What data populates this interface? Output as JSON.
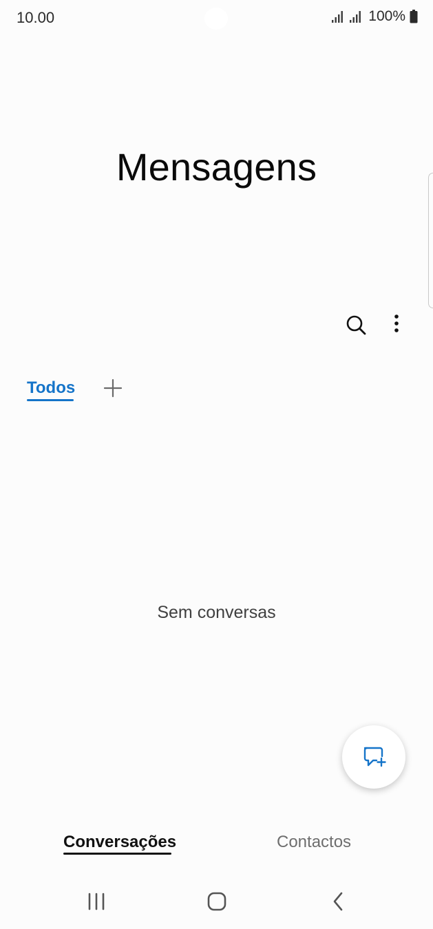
{
  "status_bar": {
    "time": "10.00",
    "battery": "100%",
    "icons": [
      "signal-icon",
      "signal-icon",
      "battery-icon"
    ]
  },
  "header": {
    "title": "Mensagens",
    "actions": [
      "search-icon",
      "more-vert-icon"
    ]
  },
  "filter_tabs": {
    "active": "Todos",
    "add_icon": "plus-icon"
  },
  "main": {
    "empty_message": "Sem conversas"
  },
  "fab": {
    "icon": "new-message-icon"
  },
  "bottom_tabs": {
    "items": [
      {
        "label": "Conversações",
        "active": true
      },
      {
        "label": "Contactos",
        "active": false
      }
    ]
  },
  "nav_bar": {
    "buttons": [
      "recents-icon",
      "home-icon",
      "back-icon"
    ]
  },
  "colors": {
    "accent": "#1574c9",
    "background": "#fcfcfc",
    "text": "#111111",
    "muted": "#6e6e6e"
  }
}
